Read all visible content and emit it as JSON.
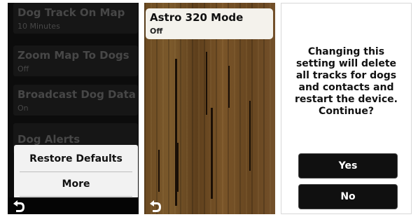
{
  "screen1": {
    "settings": [
      {
        "title": "Dog Track On Map",
        "value": "10 Minutes"
      },
      {
        "title": "Zoom Map To Dogs",
        "value": "Off"
      },
      {
        "title": "Broadcast Dog Data",
        "value": "On"
      },
      {
        "title": "Dog Alerts",
        "value": ""
      }
    ],
    "menu": {
      "restore_label": "Restore Defaults",
      "more_label": "More"
    },
    "back_icon": "back-arrow-icon"
  },
  "screen2": {
    "title": "Astro 320 Mode",
    "value": "Off",
    "back_icon": "back-arrow-icon"
  },
  "screen3": {
    "message_lines": [
      "Changing this",
      "setting will delete",
      "all tracks for dogs",
      "and contacts and",
      "restart the device.",
      "Continue?"
    ],
    "yes_label": "Yes",
    "no_label": "No"
  },
  "colors": {
    "dim_text": "#474747",
    "button_bg": "#101010",
    "panel_bg": "#f2f2f2"
  }
}
